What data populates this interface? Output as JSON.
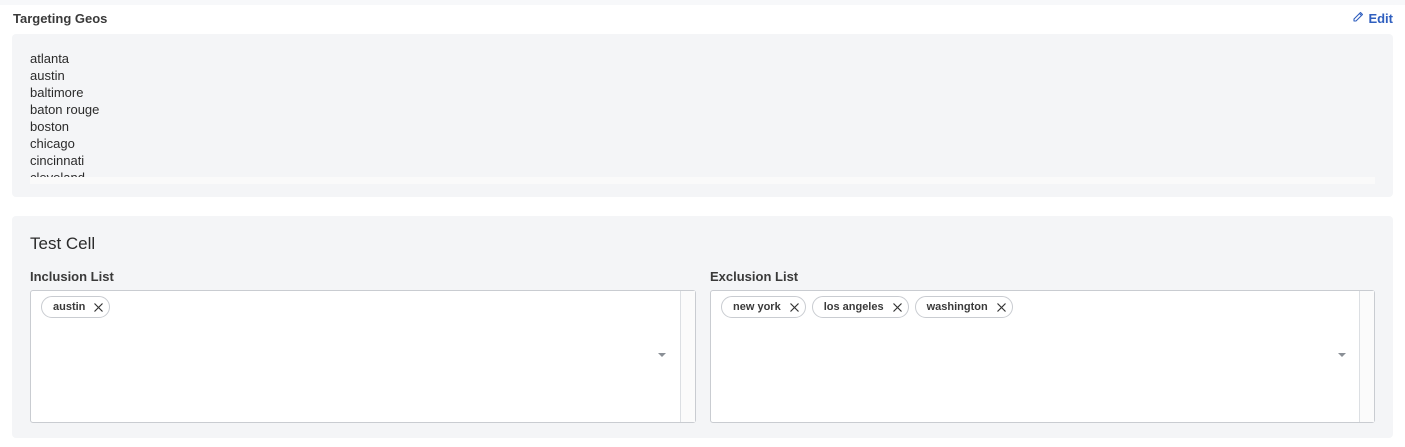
{
  "geos": {
    "title": "Targeting Geos",
    "edit_label": "Edit",
    "items": [
      "atlanta",
      "austin",
      "baltimore",
      "baton rouge",
      "boston",
      "chicago",
      "cincinnati",
      "cleveland"
    ]
  },
  "test_cell": {
    "title": "Test Cell",
    "inclusion": {
      "label": "Inclusion List",
      "chips": [
        "austin"
      ]
    },
    "exclusion": {
      "label": "Exclusion List",
      "chips": [
        "new york",
        "los angeles",
        "washington"
      ]
    }
  }
}
